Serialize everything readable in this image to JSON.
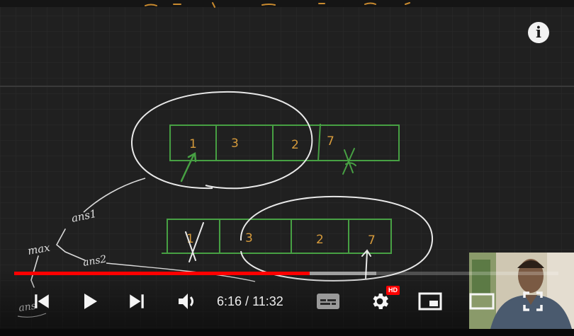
{
  "player": {
    "time_current": "6:16",
    "time_separator": " / ",
    "time_total": "11:32",
    "progress_played": 0.543,
    "progress_buffered": 0.665,
    "accent_color": "#ff0000",
    "hd_badge": "HD"
  },
  "icons": {
    "info": "info-icon",
    "previous": "skip-previous-icon",
    "play": "play-icon",
    "next": "skip-next-icon",
    "volume": "volume-icon",
    "subtitles": "subtitles-icon",
    "settings": "settings-gear-icon",
    "miniplayer": "miniplayer-icon",
    "theater": "theater-mode-icon",
    "fullscreen": "fullscreen-icon"
  },
  "whiteboard": {
    "array_top": [
      "1",
      "3",
      "2",
      "7"
    ],
    "array_bottom": [
      "1",
      "3",
      "2",
      "7"
    ],
    "notes": [
      "ans1",
      "max",
      "ans2",
      "ans"
    ]
  }
}
